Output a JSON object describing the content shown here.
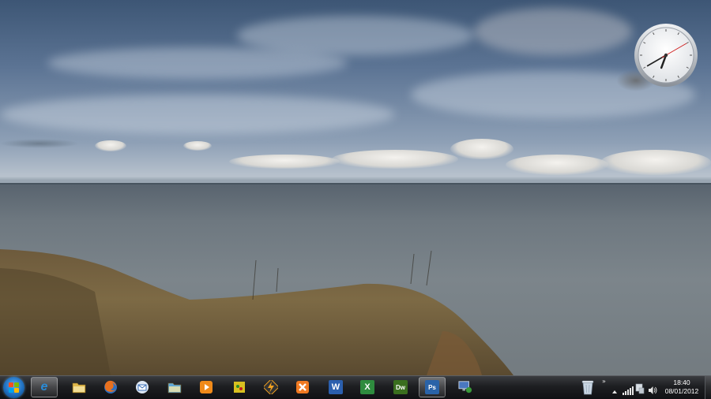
{
  "taskbar": {
    "start_icon": "windows-orb-icon",
    "pinned": [
      {
        "name": "internet-explorer",
        "icon": "e",
        "color": "#2a8bd6"
      },
      {
        "name": "windows-explorer",
        "icon": "folder-icon",
        "color": "#e0b84b"
      },
      {
        "name": "firefox",
        "icon": "firefox-icon",
        "color": "#e8701e"
      },
      {
        "name": "thunderbird",
        "icon": "thunderbird-icon",
        "color": "#3b6fb8"
      },
      {
        "name": "file-manager",
        "icon": "folder-icon",
        "color": "#5fa8d8"
      },
      {
        "name": "media-player",
        "icon": "play-icon",
        "color": "#f08a1a"
      },
      {
        "name": "notes",
        "icon": "notes-icon",
        "color": "#d8c020"
      },
      {
        "name": "winamp",
        "icon": "bolt-icon",
        "color": "#f0a020"
      },
      {
        "name": "xampp",
        "icon": "xampp-icon",
        "color": "#f07a22"
      },
      {
        "name": "word",
        "icon": "W",
        "color": "#2b5fae"
      },
      {
        "name": "excel",
        "icon": "X",
        "color": "#2e8b3e"
      },
      {
        "name": "dreamweaver",
        "icon": "Dw",
        "color": "#3a6e1e"
      },
      {
        "name": "photoshop",
        "icon": "Ps",
        "color": "#2a63a8"
      },
      {
        "name": "remote-desktop",
        "icon": "monitor-icon",
        "color": "#4a78c0"
      }
    ]
  },
  "tray": {
    "recycle_icon": "recycle-bin-icon",
    "expand_icon": "chevron-up-icon",
    "time": "18:40",
    "date": "08/01/2012"
  },
  "clock_gadget": {
    "hour": 6,
    "minute": 40
  },
  "colors": {
    "taskbar": "#1d1e21",
    "clock_face": "#f4f5f6",
    "second_hand": "#d02020"
  }
}
